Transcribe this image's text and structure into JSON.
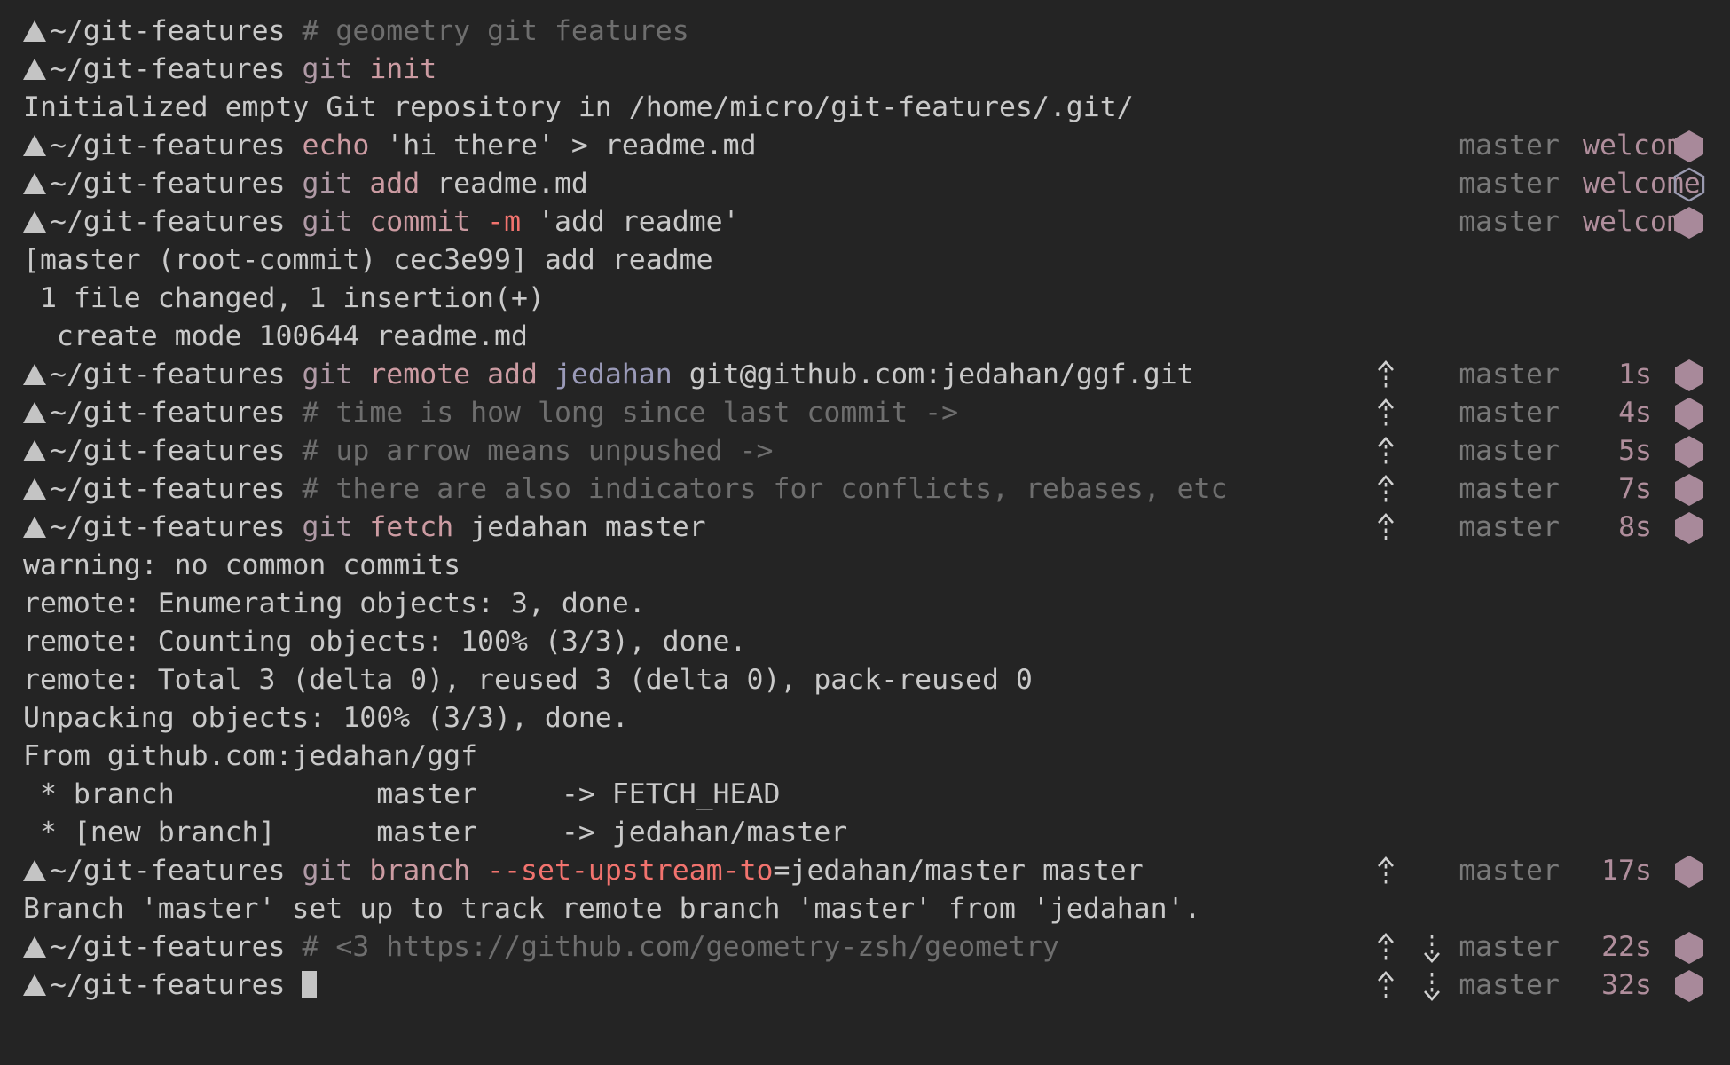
{
  "terminal": {
    "shell_theme": "geometry",
    "background_color": "#242424",
    "foreground_color": "#c9c9c9",
    "prompt_symbol": "▲",
    "prompt_path": "~/git-features",
    "cursor": "block"
  },
  "colors": {
    "comment": "#6e6e6e",
    "git_command": "#b09aa6",
    "subcommand": "#cc9ba2",
    "flag": "#f2736e",
    "remote_name": "#9a9ab8",
    "status_branch": "#7a7a7a",
    "status_time": "#b08e9c",
    "hexagon_filled": "#a8899a",
    "hexagon_hollow_stroke": "#9a9ab0",
    "arrow": "#d0d0d0"
  },
  "icons": {
    "prompt_triangle": "prompt-triangle-icon",
    "hexagon_filled": "hexagon-filled-icon",
    "hexagon_hollow": "hexagon-hollow-icon",
    "arrow_up_dashed": "arrow-up-dashed-icon",
    "arrow_down_dashed": "arrow-down-dashed-icon",
    "cursor_block": "cursor-block-icon"
  },
  "lines": [
    {
      "type": "prompt",
      "segments": [
        {
          "cls": "path",
          "text": "~/git-features "
        },
        {
          "cls": "comment",
          "text": "# geometry git features"
        }
      ],
      "status": null
    },
    {
      "type": "prompt",
      "segments": [
        {
          "cls": "path",
          "text": "~/git-features "
        },
        {
          "cls": "gitcmd",
          "text": "git "
        },
        {
          "cls": "subcmd",
          "text": "init"
        }
      ],
      "status": null
    },
    {
      "type": "output",
      "text": "Initialized empty Git repository in /home/micro/git-features/.git/"
    },
    {
      "type": "prompt",
      "segments": [
        {
          "cls": "path",
          "text": "~/git-features "
        },
        {
          "cls": "subcmd",
          "text": "echo "
        },
        {
          "cls": "str",
          "text": "'hi there' > readme.md"
        }
      ],
      "status": {
        "up": false,
        "down": false,
        "branch": "master",
        "time": "welcome",
        "hex": "filled"
      }
    },
    {
      "type": "prompt",
      "segments": [
        {
          "cls": "path",
          "text": "~/git-features "
        },
        {
          "cls": "gitcmd",
          "text": "git "
        },
        {
          "cls": "subcmd",
          "text": "add "
        },
        {
          "cls": "arg",
          "text": "readme.md"
        }
      ],
      "status": {
        "up": false,
        "down": false,
        "branch": "master",
        "time": "welcome",
        "hex": "hollow"
      }
    },
    {
      "type": "prompt",
      "segments": [
        {
          "cls": "path",
          "text": "~/git-features "
        },
        {
          "cls": "gitcmd",
          "text": "git "
        },
        {
          "cls": "subcmd",
          "text": "commit "
        },
        {
          "cls": "flag",
          "text": "-m "
        },
        {
          "cls": "str",
          "text": "'add readme'"
        }
      ],
      "status": {
        "up": false,
        "down": false,
        "branch": "master",
        "time": "welcome",
        "hex": "filled"
      }
    },
    {
      "type": "output",
      "text": "[master (root-commit) cec3e99] add readme"
    },
    {
      "type": "output",
      "text": " 1 file changed, 1 insertion(+)"
    },
    {
      "type": "output",
      "text": "  create mode 100644 readme.md"
    },
    {
      "type": "prompt",
      "segments": [
        {
          "cls": "path",
          "text": "~/git-features "
        },
        {
          "cls": "gitcmd",
          "text": "git "
        },
        {
          "cls": "subcmd",
          "text": "remote add "
        },
        {
          "cls": "remote",
          "text": "jedahan "
        },
        {
          "cls": "arg",
          "text": "git@github.com:jedahan/ggf.git"
        }
      ],
      "status": {
        "up": true,
        "down": false,
        "branch": "master",
        "time": "1s",
        "hex": "filled"
      }
    },
    {
      "type": "prompt",
      "segments": [
        {
          "cls": "path",
          "text": "~/git-features "
        },
        {
          "cls": "comment",
          "text": "# time is how long since last commit ->"
        }
      ],
      "status": {
        "up": true,
        "down": false,
        "branch": "master",
        "time": "4s",
        "hex": "filled"
      }
    },
    {
      "type": "prompt",
      "segments": [
        {
          "cls": "path",
          "text": "~/git-features "
        },
        {
          "cls": "comment",
          "text": "# up arrow means unpushed ->"
        }
      ],
      "status": {
        "up": true,
        "down": false,
        "branch": "master",
        "time": "5s",
        "hex": "filled"
      }
    },
    {
      "type": "prompt",
      "segments": [
        {
          "cls": "path",
          "text": "~/git-features "
        },
        {
          "cls": "comment",
          "text": "# there are also indicators for conflicts, rebases, etc"
        }
      ],
      "status": {
        "up": true,
        "down": false,
        "branch": "master",
        "time": "7s",
        "hex": "filled"
      }
    },
    {
      "type": "prompt",
      "segments": [
        {
          "cls": "path",
          "text": "~/git-features "
        },
        {
          "cls": "gitcmd",
          "text": "git "
        },
        {
          "cls": "subcmd",
          "text": "fetch "
        },
        {
          "cls": "arg",
          "text": "jedahan master"
        }
      ],
      "status": {
        "up": true,
        "down": false,
        "branch": "master",
        "time": "8s",
        "hex": "filled"
      }
    },
    {
      "type": "output",
      "text": "warning: no common commits"
    },
    {
      "type": "output",
      "text": "remote: Enumerating objects: 3, done."
    },
    {
      "type": "output",
      "text": "remote: Counting objects: 100% (3/3), done."
    },
    {
      "type": "output",
      "text": "remote: Total 3 (delta 0), reused 3 (delta 0), pack-reused 0"
    },
    {
      "type": "output",
      "text": "Unpacking objects: 100% (3/3), done."
    },
    {
      "type": "output",
      "text": "From github.com:jedahan/ggf"
    },
    {
      "type": "output",
      "text": " * branch            master     -> FETCH_HEAD"
    },
    {
      "type": "output",
      "text": " * [new branch]      master     -> jedahan/master"
    },
    {
      "type": "prompt",
      "segments": [
        {
          "cls": "path",
          "text": "~/git-features "
        },
        {
          "cls": "gitcmd",
          "text": "git "
        },
        {
          "cls": "subcmd",
          "text": "branch "
        },
        {
          "cls": "flag",
          "text": "--set-upstream-to"
        },
        {
          "cls": "arg",
          "text": "=jedahan/master master"
        }
      ],
      "status": {
        "up": true,
        "down": false,
        "branch": "master",
        "time": "17s",
        "hex": "filled"
      }
    },
    {
      "type": "output",
      "text": "Branch 'master' set up to track remote branch 'master' from 'jedahan'."
    },
    {
      "type": "prompt",
      "segments": [
        {
          "cls": "path",
          "text": "~/git-features "
        },
        {
          "cls": "comment",
          "text": "# <3 https://github.com/geometry-zsh/geometry"
        }
      ],
      "status": {
        "up": true,
        "down": true,
        "branch": "master",
        "time": "22s",
        "hex": "filled"
      }
    },
    {
      "type": "prompt",
      "cursor": true,
      "segments": [
        {
          "cls": "path",
          "text": "~/git-features "
        }
      ],
      "status": {
        "up": true,
        "down": true,
        "branch": "master",
        "time": "32s",
        "hex": "filled"
      }
    }
  ]
}
